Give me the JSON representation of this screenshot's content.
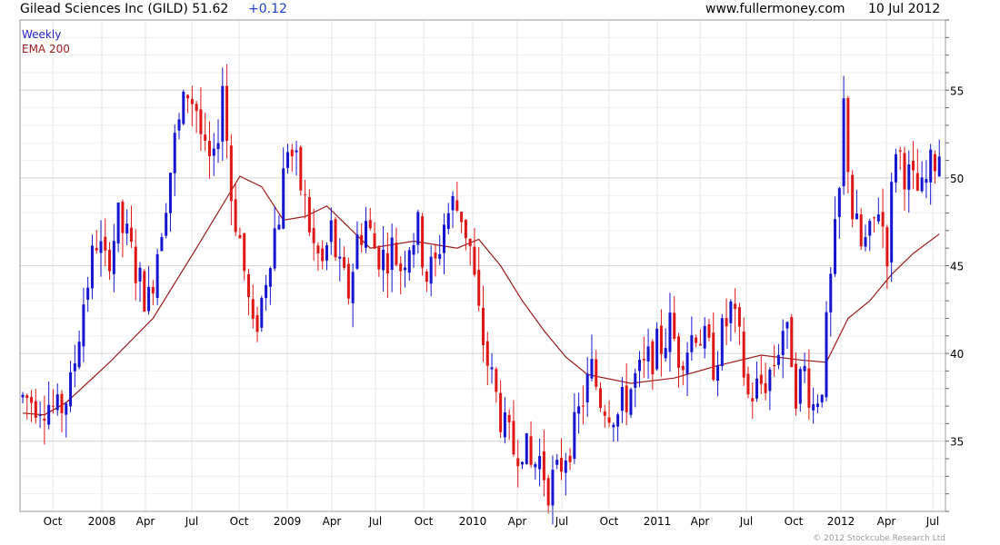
{
  "header": {
    "title": "Gilead Sciences Inc (GILD) 51.62",
    "change": "+0.12",
    "site": "www.fullermoney.com",
    "date": "10 Jul 2012"
  },
  "legend": {
    "weekly": "Weekly",
    "ema": "EMA 200"
  },
  "copyright": "© 2012 Stockcube Research Ltd",
  "colors": {
    "up": "#1515d0",
    "down": "#e01515",
    "ema": "#9b1b1b",
    "grid": "#d6d6d6",
    "change_text": "#1f3fd1"
  },
  "chart_data": {
    "type": "candlestick",
    "timeframe": "weekly",
    "ylim": [
      31,
      59
    ],
    "y_ticks": [
      35,
      40,
      45,
      50,
      55
    ],
    "x_ticks": [
      "Oct",
      "2008",
      "Apr",
      "Jul",
      "Oct",
      "2009",
      "Apr",
      "Jul",
      "Oct",
      "2010",
      "Apr",
      "Jul",
      "Oct",
      "2011",
      "Apr",
      "Jul",
      "Oct",
      "2012",
      "Apr",
      "Jul"
    ],
    "price_path": [
      [
        0,
        37.5
      ],
      [
        6,
        37.2
      ],
      [
        8,
        36.5
      ],
      [
        11,
        38.0
      ],
      [
        14,
        43.0
      ],
      [
        17,
        46.5
      ],
      [
        19,
        45.0
      ],
      [
        22,
        47.5
      ],
      [
        24,
        46.5
      ],
      [
        27,
        44.0
      ],
      [
        29,
        43.0
      ],
      [
        32,
        47.5
      ],
      [
        35,
        52.0
      ],
      [
        38,
        55.0
      ],
      [
        40,
        54.0
      ],
      [
        42,
        51.0
      ],
      [
        44,
        50.5
      ],
      [
        46,
        55.5
      ],
      [
        48,
        49.0
      ],
      [
        50,
        46.5
      ],
      [
        53,
        41.0
      ],
      [
        55,
        43.0
      ],
      [
        57,
        46.0
      ],
      [
        59,
        48.0
      ],
      [
        61,
        52.0
      ],
      [
        63,
        50.5
      ],
      [
        65,
        48.5
      ],
      [
        67,
        46.0
      ],
      [
        69,
        45.0
      ],
      [
        71,
        47.0
      ],
      [
        73,
        44.5
      ],
      [
        75,
        43.5
      ],
      [
        77,
        46.5
      ],
      [
        79,
        47.5
      ],
      [
        81,
        46.0
      ],
      [
        83,
        45.5
      ],
      [
        85,
        46.0
      ],
      [
        87,
        45.0
      ],
      [
        89,
        46.5
      ],
      [
        91,
        47.0
      ],
      [
        93,
        44.5
      ],
      [
        95,
        45.0
      ],
      [
        97,
        47.5
      ],
      [
        99,
        48.5
      ],
      [
        101,
        48.0
      ],
      [
        103,
        46.0
      ],
      [
        105,
        42.0
      ],
      [
        107,
        39.5
      ],
      [
        109,
        37.5
      ],
      [
        111,
        35.5
      ],
      [
        113,
        34.5
      ],
      [
        115,
        35.0
      ],
      [
        117,
        33.5
      ],
      [
        119,
        34.0
      ],
      [
        121,
        32.5
      ],
      [
        123,
        33.0
      ],
      [
        125,
        34.5
      ],
      [
        127,
        35.5
      ],
      [
        129,
        37.5
      ],
      [
        131,
        39.0
      ],
      [
        133,
        37.5
      ],
      [
        135,
        37.0
      ],
      [
        137,
        36.5
      ],
      [
        139,
        37.5
      ],
      [
        141,
        38.5
      ],
      [
        143,
        39.0
      ],
      [
        145,
        40.0
      ],
      [
        147,
        40.5
      ],
      [
        149,
        41.5
      ],
      [
        151,
        40.0
      ],
      [
        153,
        40.5
      ],
      [
        155,
        41.5
      ],
      [
        157,
        40.5
      ],
      [
        159,
        39.5
      ],
      [
        161,
        41.0
      ],
      [
        163,
        42.5
      ],
      [
        165,
        40.5
      ],
      [
        167,
        37.5
      ],
      [
        169,
        38.0
      ],
      [
        171,
        38.5
      ],
      [
        173,
        39.5
      ],
      [
        175,
        41.5
      ],
      [
        177,
        40.0
      ],
      [
        178,
        38.0
      ],
      [
        180,
        39.0
      ],
      [
        182,
        37.0
      ],
      [
        184,
        38.5
      ],
      [
        186,
        44.0
      ],
      [
        188,
        49.0
      ],
      [
        189,
        54.0
      ],
      [
        191,
        48.0
      ],
      [
        193,
        46.0
      ],
      [
        195,
        46.5
      ],
      [
        197,
        48.5
      ],
      [
        199,
        46.0
      ],
      [
        201,
        52.0
      ],
      [
        203,
        50.5
      ],
      [
        205,
        49.5
      ],
      [
        207,
        49.0
      ],
      [
        209,
        50.5
      ],
      [
        211,
        51.6
      ]
    ],
    "ema_path": [
      [
        0,
        36.6
      ],
      [
        5,
        36.5
      ],
      [
        10,
        37.2
      ],
      [
        20,
        39.5
      ],
      [
        30,
        42.0
      ],
      [
        40,
        46.0
      ],
      [
        50,
        50.1
      ],
      [
        55,
        49.5
      ],
      [
        60,
        47.6
      ],
      [
        65,
        47.8
      ],
      [
        70,
        48.4
      ],
      [
        80,
        46.0
      ],
      [
        90,
        46.4
      ],
      [
        100,
        46.0
      ],
      [
        105,
        46.5
      ],
      [
        110,
        45.0
      ],
      [
        115,
        43.0
      ],
      [
        120,
        41.3
      ],
      [
        125,
        39.8
      ],
      [
        130,
        38.8
      ],
      [
        140,
        38.3
      ],
      [
        150,
        38.6
      ],
      [
        160,
        39.3
      ],
      [
        170,
        39.9
      ],
      [
        180,
        39.6
      ],
      [
        185,
        39.5
      ],
      [
        190,
        42.0
      ],
      [
        195,
        43.0
      ],
      [
        200,
        44.5
      ],
      [
        205,
        45.7
      ],
      [
        211,
        46.8
      ]
    ]
  }
}
